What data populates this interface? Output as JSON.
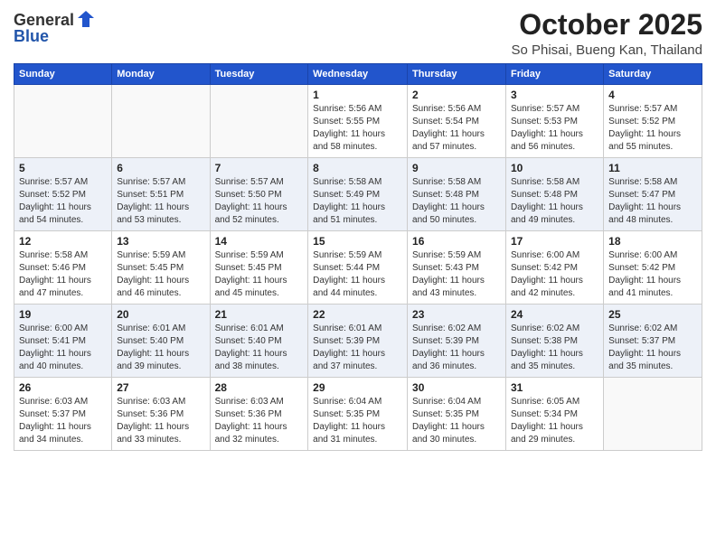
{
  "header": {
    "logo_general": "General",
    "logo_blue": "Blue",
    "month": "October 2025",
    "location": "So Phisai, Bueng Kan, Thailand"
  },
  "weekdays": [
    "Sunday",
    "Monday",
    "Tuesday",
    "Wednesday",
    "Thursday",
    "Friday",
    "Saturday"
  ],
  "rows": [
    [
      {
        "day": "",
        "sunrise": "",
        "sunset": "",
        "daylight": ""
      },
      {
        "day": "",
        "sunrise": "",
        "sunset": "",
        "daylight": ""
      },
      {
        "day": "",
        "sunrise": "",
        "sunset": "",
        "daylight": ""
      },
      {
        "day": "1",
        "sunrise": "5:56 AM",
        "sunset": "5:55 PM",
        "daylight": "11 hours and 58 minutes."
      },
      {
        "day": "2",
        "sunrise": "5:56 AM",
        "sunset": "5:54 PM",
        "daylight": "11 hours and 57 minutes."
      },
      {
        "day": "3",
        "sunrise": "5:57 AM",
        "sunset": "5:53 PM",
        "daylight": "11 hours and 56 minutes."
      },
      {
        "day": "4",
        "sunrise": "5:57 AM",
        "sunset": "5:52 PM",
        "daylight": "11 hours and 55 minutes."
      }
    ],
    [
      {
        "day": "5",
        "sunrise": "5:57 AM",
        "sunset": "5:52 PM",
        "daylight": "11 hours and 54 minutes."
      },
      {
        "day": "6",
        "sunrise": "5:57 AM",
        "sunset": "5:51 PM",
        "daylight": "11 hours and 53 minutes."
      },
      {
        "day": "7",
        "sunrise": "5:57 AM",
        "sunset": "5:50 PM",
        "daylight": "11 hours and 52 minutes."
      },
      {
        "day": "8",
        "sunrise": "5:58 AM",
        "sunset": "5:49 PM",
        "daylight": "11 hours and 51 minutes."
      },
      {
        "day": "9",
        "sunrise": "5:58 AM",
        "sunset": "5:48 PM",
        "daylight": "11 hours and 50 minutes."
      },
      {
        "day": "10",
        "sunrise": "5:58 AM",
        "sunset": "5:48 PM",
        "daylight": "11 hours and 49 minutes."
      },
      {
        "day": "11",
        "sunrise": "5:58 AM",
        "sunset": "5:47 PM",
        "daylight": "11 hours and 48 minutes."
      }
    ],
    [
      {
        "day": "12",
        "sunrise": "5:58 AM",
        "sunset": "5:46 PM",
        "daylight": "11 hours and 47 minutes."
      },
      {
        "day": "13",
        "sunrise": "5:59 AM",
        "sunset": "5:45 PM",
        "daylight": "11 hours and 46 minutes."
      },
      {
        "day": "14",
        "sunrise": "5:59 AM",
        "sunset": "5:45 PM",
        "daylight": "11 hours and 45 minutes."
      },
      {
        "day": "15",
        "sunrise": "5:59 AM",
        "sunset": "5:44 PM",
        "daylight": "11 hours and 44 minutes."
      },
      {
        "day": "16",
        "sunrise": "5:59 AM",
        "sunset": "5:43 PM",
        "daylight": "11 hours and 43 minutes."
      },
      {
        "day": "17",
        "sunrise": "6:00 AM",
        "sunset": "5:42 PM",
        "daylight": "11 hours and 42 minutes."
      },
      {
        "day": "18",
        "sunrise": "6:00 AM",
        "sunset": "5:42 PM",
        "daylight": "11 hours and 41 minutes."
      }
    ],
    [
      {
        "day": "19",
        "sunrise": "6:00 AM",
        "sunset": "5:41 PM",
        "daylight": "11 hours and 40 minutes."
      },
      {
        "day": "20",
        "sunrise": "6:01 AM",
        "sunset": "5:40 PM",
        "daylight": "11 hours and 39 minutes."
      },
      {
        "day": "21",
        "sunrise": "6:01 AM",
        "sunset": "5:40 PM",
        "daylight": "11 hours and 38 minutes."
      },
      {
        "day": "22",
        "sunrise": "6:01 AM",
        "sunset": "5:39 PM",
        "daylight": "11 hours and 37 minutes."
      },
      {
        "day": "23",
        "sunrise": "6:02 AM",
        "sunset": "5:39 PM",
        "daylight": "11 hours and 36 minutes."
      },
      {
        "day": "24",
        "sunrise": "6:02 AM",
        "sunset": "5:38 PM",
        "daylight": "11 hours and 35 minutes."
      },
      {
        "day": "25",
        "sunrise": "6:02 AM",
        "sunset": "5:37 PM",
        "daylight": "11 hours and 35 minutes."
      }
    ],
    [
      {
        "day": "26",
        "sunrise": "6:03 AM",
        "sunset": "5:37 PM",
        "daylight": "11 hours and 34 minutes."
      },
      {
        "day": "27",
        "sunrise": "6:03 AM",
        "sunset": "5:36 PM",
        "daylight": "11 hours and 33 minutes."
      },
      {
        "day": "28",
        "sunrise": "6:03 AM",
        "sunset": "5:36 PM",
        "daylight": "11 hours and 32 minutes."
      },
      {
        "day": "29",
        "sunrise": "6:04 AM",
        "sunset": "5:35 PM",
        "daylight": "11 hours and 31 minutes."
      },
      {
        "day": "30",
        "sunrise": "6:04 AM",
        "sunset": "5:35 PM",
        "daylight": "11 hours and 30 minutes."
      },
      {
        "day": "31",
        "sunrise": "6:05 AM",
        "sunset": "5:34 PM",
        "daylight": "11 hours and 29 minutes."
      },
      {
        "day": "",
        "sunrise": "",
        "sunset": "",
        "daylight": ""
      }
    ]
  ],
  "labels": {
    "sunrise": "Sunrise:",
    "sunset": "Sunset:",
    "daylight": "Daylight hours"
  }
}
